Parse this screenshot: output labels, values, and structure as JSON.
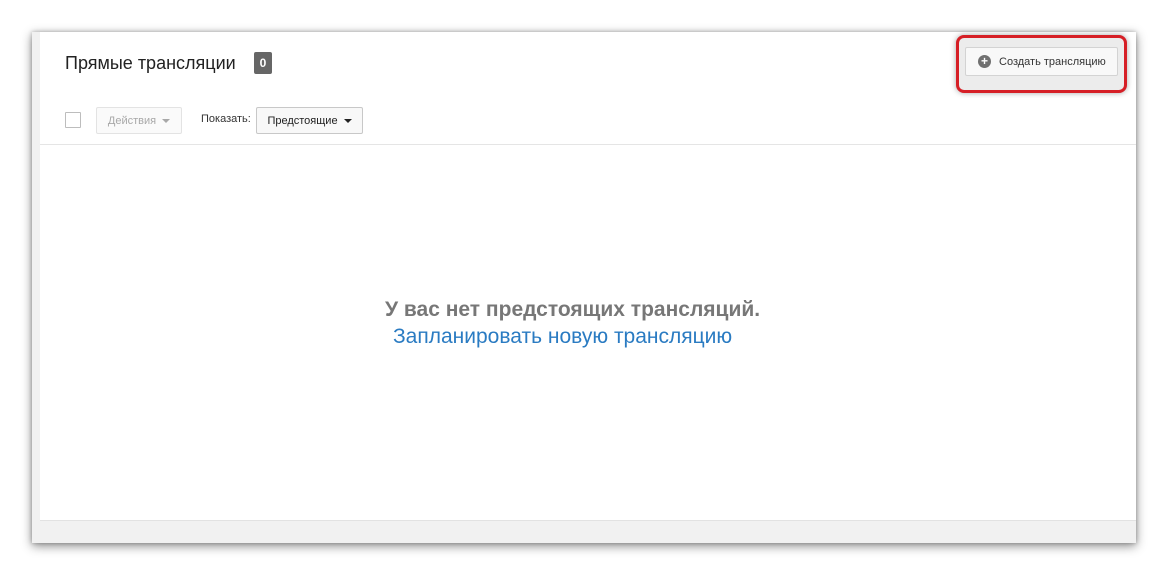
{
  "header": {
    "title": "Прямые трансляции",
    "count": "0",
    "create_button_label": "Создать трансляцию"
  },
  "toolbar": {
    "actions_label": "Действия",
    "show_label": "Показать:",
    "filter_value": "Предстоящие"
  },
  "empty_state": {
    "message": "У вас нет предстоящих трансляций.",
    "link_text": "Запланировать новую трансляцию"
  },
  "icons": {
    "create": "plus-circle-icon",
    "dropdown": "caret-down-icon"
  },
  "colors": {
    "highlight": "#d61f26",
    "link": "#2a7bc2",
    "badge": "#666666"
  }
}
